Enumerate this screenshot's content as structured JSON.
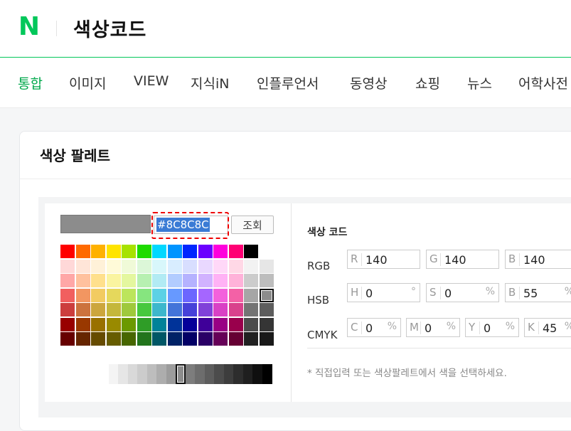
{
  "header": {
    "logo": "N",
    "query": "색상코드",
    "brand_color": "#03c75a"
  },
  "tabs": [
    {
      "label": "통합",
      "active": true
    },
    {
      "label": "이미지"
    },
    {
      "label": "VIEW"
    },
    {
      "label": "지식iN"
    },
    {
      "label": "인플루언서"
    },
    {
      "label": "동영상"
    },
    {
      "label": "쇼핑"
    },
    {
      "label": "뉴스"
    },
    {
      "label": "어학사전"
    }
  ],
  "card": {
    "title": "색상 팔레트"
  },
  "picker": {
    "preview_color": "#8C8C8C",
    "hex_value": "#8C8C8C",
    "lookup_label": "조회"
  },
  "palette": {
    "rows": [
      [
        "#FF0000",
        "#FF6A00",
        "#FFB100",
        "#FFE400",
        "#A7E200",
        "#1EDB00",
        "#00D8FF",
        "#0094FF",
        "#0026FF",
        "#6B00FF",
        "#FF00DC",
        "#FF0074",
        "#000000"
      ],
      [
        "#FFD8D8",
        "#FFE5D8",
        "#FFF1D8",
        "#FFFAD8",
        "#F0FAD8",
        "#DCF7D8",
        "#D8F7FB",
        "#D8EDFF",
        "#D8DEFF",
        "#E9D8FF",
        "#FFD8F8",
        "#FFD8E6",
        "#F2F2F2",
        "#E6E6E6"
      ],
      [
        "#FFA7A7",
        "#FFC19E",
        "#FFE08C",
        "#FAF4A0",
        "#E4F79F",
        "#B7F0B1",
        "#B2EBF4",
        "#B2CCFF",
        "#B5B2FF",
        "#D1B2FF",
        "#FFB2F5",
        "#FFB2D9",
        "#CCCCCC",
        "#BDBDBD"
      ],
      [
        "#F15F5F",
        "#F29661",
        "#F2CB61",
        "#E5D85C",
        "#BCE55C",
        "#86E57F",
        "#5CD1E5",
        "#6799FF",
        "#6B66FF",
        "#A566FF",
        "#F361DC",
        "#F361A6",
        "#A6A6A6",
        "#8C8C8C"
      ],
      [
        "#CC3D3D",
        "#CC723D",
        "#CCA63D",
        "#C4B73B",
        "#9FC93C",
        "#47C83E",
        "#3DB7CC",
        "#4374D9",
        "#4641D9",
        "#8041D9",
        "#D941C5",
        "#D9418C",
        "#747474",
        "#5D5D5D"
      ],
      [
        "#980000",
        "#993800",
        "#997000",
        "#998A00",
        "#6B9900",
        "#2F9D27",
        "#008299",
        "#003399",
        "#050099",
        "#3F0099",
        "#990085",
        "#99004C",
        "#4C4C4C",
        "#353535"
      ],
      [
        "#670000",
        "#662500",
        "#664B00",
        "#665C00",
        "#476600",
        "#22741C",
        "#005766",
        "#002266",
        "#030066",
        "#2A0066",
        "#660058",
        "#660033",
        "#212121",
        "#191919"
      ]
    ],
    "selected": "#8C8C8C",
    "grayscale": [
      "#FFFFFF",
      "#FFFFFF",
      "#FFFFFF",
      "#FFFFFF",
      "#FFFFFF",
      "#F4F4F4",
      "#E6E6E6",
      "#D9D9D9",
      "#CCCCCC",
      "#BDBDBD",
      "#ADADAD",
      "#9C9C9C",
      "#8C8C8C",
      "#7D7D7D",
      "#6D6D6D",
      "#5D5D5D",
      "#4C4C4C",
      "#3D3D3D",
      "#2D2D2D",
      "#1F1F1F",
      "#0F0F0F",
      "#000000"
    ],
    "gray_selected_index": 12
  },
  "codes": {
    "title": "색상 코드",
    "rgb": {
      "label": "RGB",
      "fields": [
        {
          "l": "R",
          "v": "140"
        },
        {
          "l": "G",
          "v": "140"
        },
        {
          "l": "B",
          "v": "140"
        }
      ]
    },
    "hsb": {
      "label": "HSB",
      "fields": [
        {
          "l": "H",
          "v": "0",
          "u": "°"
        },
        {
          "l": "S",
          "v": "0",
          "u": "%"
        },
        {
          "l": "B",
          "v": "55",
          "u": "%"
        }
      ]
    },
    "cmyk": {
      "label": "CMYK",
      "fields": [
        {
          "l": "C",
          "v": "0",
          "u": "%"
        },
        {
          "l": "M",
          "v": "0",
          "u": "%"
        },
        {
          "l": "Y",
          "v": "0",
          "u": "%"
        },
        {
          "l": "K",
          "v": "45",
          "u": "%"
        }
      ]
    },
    "note": "* 직접입력 또는 색상팔레트에서 색을 선택하세요."
  }
}
